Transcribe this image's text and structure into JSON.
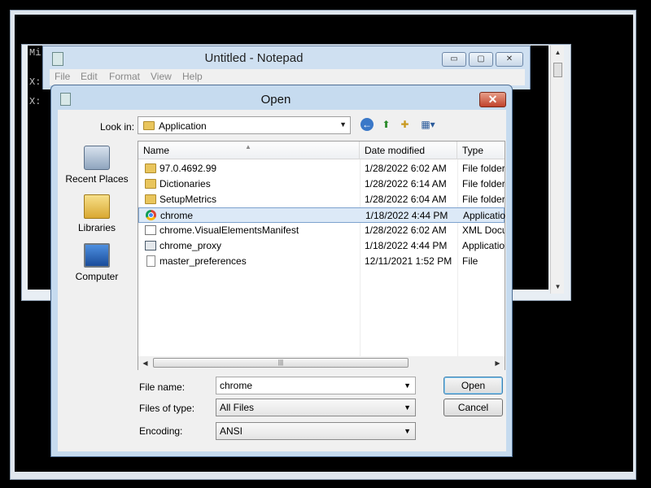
{
  "console": {
    "lines": [
      "Mi",
      "X:",
      "X:"
    ]
  },
  "notepad": {
    "title": "Untitled - Notepad",
    "buttons": {
      "minimize": "▭",
      "maximize": "▢",
      "close": "✕"
    },
    "menu": [
      "File",
      "Edit",
      "Format",
      "View",
      "Help"
    ]
  },
  "dialog": {
    "title": "Open",
    "close_label": "✕",
    "look_in_label": "Look in:",
    "look_in_value": "Application",
    "places": [
      {
        "label": "Recent Places",
        "icon": "recent-places-icon"
      },
      {
        "label": "Libraries",
        "icon": "libraries-icon"
      },
      {
        "label": "Computer",
        "icon": "computer-icon"
      }
    ],
    "columns": [
      "Name",
      "Date modified",
      "Type"
    ],
    "files": [
      {
        "name": "97.0.4692.99",
        "date": "1/28/2022 6:02 AM",
        "type": "File folder",
        "icon": "folder-icon",
        "selected": false
      },
      {
        "name": "Dictionaries",
        "date": "1/28/2022 6:14 AM",
        "type": "File folder",
        "icon": "folder-icon",
        "selected": false
      },
      {
        "name": "SetupMetrics",
        "date": "1/28/2022 6:04 AM",
        "type": "File folder",
        "icon": "folder-icon",
        "selected": false
      },
      {
        "name": "chrome",
        "date": "1/18/2022 4:44 PM",
        "type": "Application",
        "icon": "chrome-icon",
        "selected": true
      },
      {
        "name": "chrome.VisualElementsManifest",
        "date": "1/28/2022 6:02 AM",
        "type": "XML Document",
        "icon": "xml-file-icon",
        "selected": false
      },
      {
        "name": "chrome_proxy",
        "date": "1/18/2022 4:44 PM",
        "type": "Application",
        "icon": "application-icon",
        "selected": false
      },
      {
        "name": "master_preferences",
        "date": "12/11/2021 1:52 PM",
        "type": "File",
        "icon": "file-icon",
        "selected": false
      }
    ],
    "scroll_grip": "|||",
    "file_name_label": "File name:",
    "file_name_value": "chrome",
    "files_of_type_label": "Files of type:",
    "files_of_type_value": "All Files",
    "encoding_label": "Encoding:",
    "encoding_value": "ANSI",
    "open_label": "Open",
    "cancel_label": "Cancel"
  }
}
